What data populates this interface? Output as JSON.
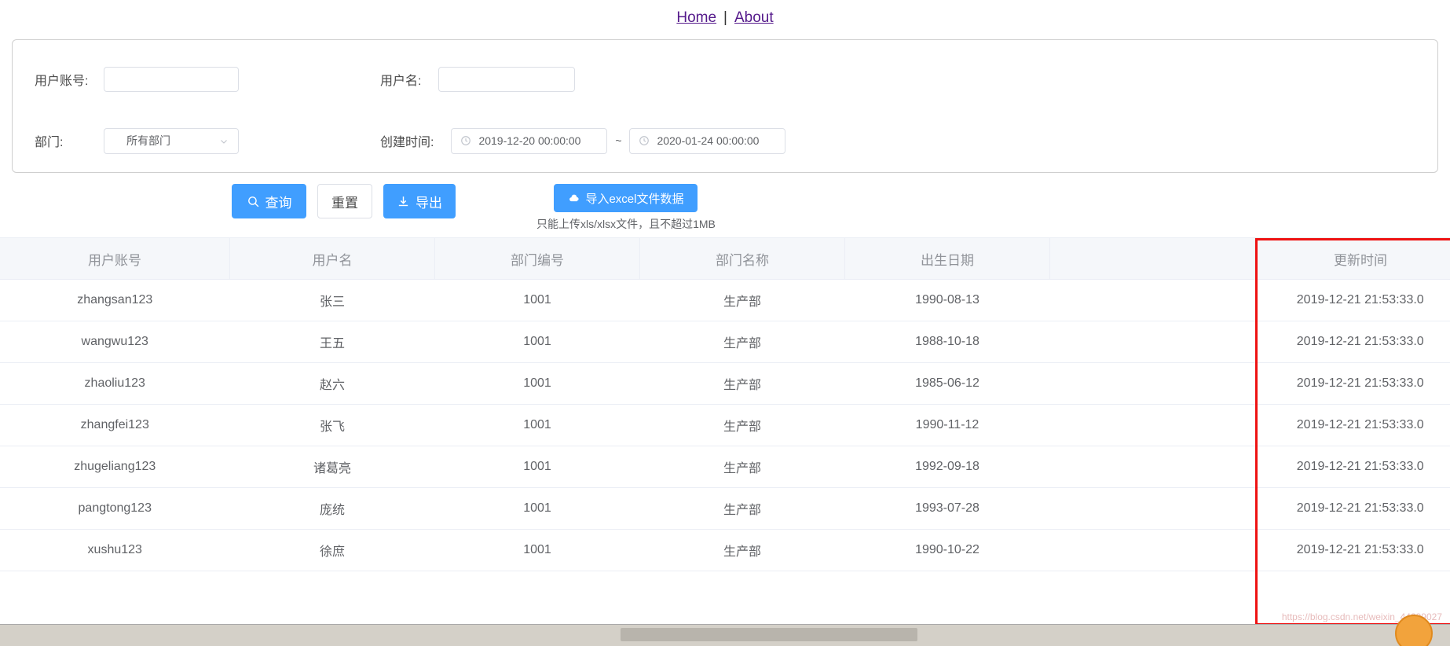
{
  "nav": {
    "home": "Home",
    "separator": "|",
    "about": "About"
  },
  "search_form": {
    "account_label": "用户账号:",
    "account_value": "",
    "account_placeholder": "",
    "username_label": "用户名:",
    "username_value": "",
    "username_placeholder": "",
    "dept_label": "部门:",
    "dept_value": "所有部门",
    "create_time_label": "创建时间:",
    "date_start": "2019-12-20 00:00:00",
    "date_end": "2020-01-24 00:00:00",
    "range_separator": "~"
  },
  "actions": {
    "query": "查询",
    "reset": "重置",
    "export": "导出",
    "import": "导入excel文件数据",
    "upload_tip": "只能上传xls/xlsx文件，且不超过1MB"
  },
  "table": {
    "columns": [
      "用户账号",
      "用户名",
      "部门编号",
      "部门名称",
      "出生日期",
      "",
      "更新时间"
    ],
    "rows": [
      [
        "zhangsan123",
        "张三",
        "1001",
        "生产部",
        "1990-08-13",
        "",
        "2019-12-21 21:53:33.0"
      ],
      [
        "wangwu123",
        "王五",
        "1001",
        "生产部",
        "1988-10-18",
        "",
        "2019-12-21 21:53:33.0"
      ],
      [
        "zhaoliu123",
        "赵六",
        "1001",
        "生产部",
        "1985-06-12",
        "",
        "2019-12-21 21:53:33.0"
      ],
      [
        "zhangfei123",
        "张飞",
        "1001",
        "生产部",
        "1990-11-12",
        "",
        "2019-12-21 21:53:33.0"
      ],
      [
        "zhugeliang123",
        "诸葛亮",
        "1001",
        "生产部",
        "1992-09-18",
        "",
        "2019-12-21 21:53:33.0"
      ],
      [
        "pangtong123",
        "庞统",
        "1001",
        "生产部",
        "1993-07-28",
        "",
        "2019-12-21 21:53:33.0"
      ],
      [
        "xushu123",
        "徐庶",
        "1001",
        "生产部",
        "1990-10-22",
        "",
        "2019-12-21 21:53:33.0"
      ]
    ]
  },
  "annotation": {
    "highlight_color": "#ee1111",
    "highlight_column": "更新时间"
  },
  "theme": {
    "primary": "#409eff",
    "link": "#551a8b",
    "header_bg": "#f5f7fa",
    "border": "#ebeef5"
  },
  "watermark": "https://blog.csdn.net/weixin_44299027"
}
